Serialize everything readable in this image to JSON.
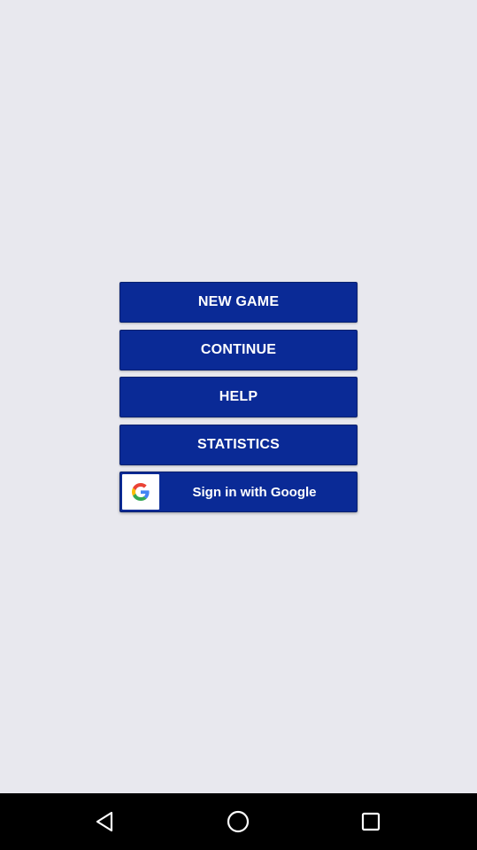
{
  "menu": {
    "buttons": [
      {
        "label": "NEW GAME"
      },
      {
        "label": "CONTINUE"
      },
      {
        "label": "HELP"
      },
      {
        "label": "STATISTICS"
      }
    ],
    "google_signin_label": "Sign in with Google"
  },
  "colors": {
    "background": "#e8e8ee",
    "button": "#0a2a96",
    "navbar": "#000000"
  },
  "navbar": {
    "icons": [
      "back-icon",
      "home-icon",
      "recents-icon"
    ]
  }
}
